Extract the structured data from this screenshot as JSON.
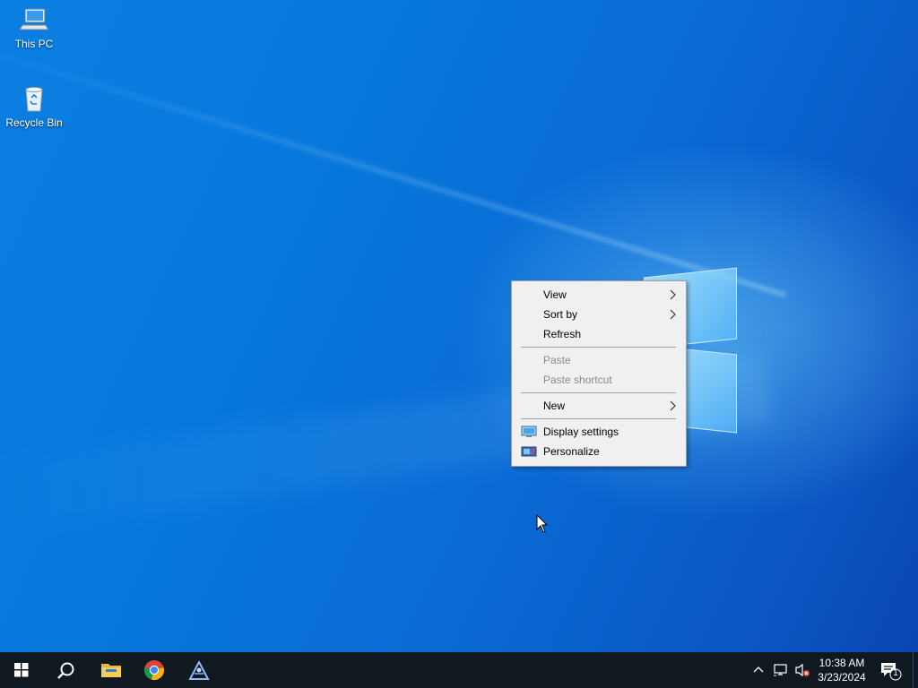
{
  "desktop": {
    "icons": [
      {
        "label": "This PC",
        "icon": "computer-icon"
      },
      {
        "label": "Recycle Bin",
        "icon": "recycle-bin-icon"
      }
    ]
  },
  "context_menu": {
    "items": [
      {
        "label": "View",
        "submenu": true,
        "enabled": true
      },
      {
        "label": "Sort by",
        "submenu": true,
        "enabled": true
      },
      {
        "label": "Refresh",
        "submenu": false,
        "enabled": true
      },
      {
        "label": "Paste",
        "submenu": false,
        "enabled": false
      },
      {
        "label": "Paste shortcut",
        "submenu": false,
        "enabled": false
      },
      {
        "label": "New",
        "submenu": true,
        "enabled": true
      },
      {
        "label": "Display settings",
        "submenu": false,
        "enabled": true,
        "icon": "display-settings-icon"
      },
      {
        "label": "Personalize",
        "submenu": false,
        "enabled": true,
        "icon": "personalize-icon"
      }
    ]
  },
  "taskbar": {
    "pinned": [
      "start-icon",
      "search-icon",
      "file-explorer-icon",
      "chrome-icon",
      "app-icon"
    ],
    "tray": [
      "show-hidden-icons-icon",
      "network-icon",
      "volume-muted-icon"
    ],
    "clock": {
      "time": "10:38 AM",
      "date": "3/23/2024"
    },
    "notification_count": "1"
  },
  "colors": {
    "taskbar_bg": "#101820",
    "menu_bg": "#f0f0f0",
    "desktop_accent": "#0a7fe2"
  }
}
